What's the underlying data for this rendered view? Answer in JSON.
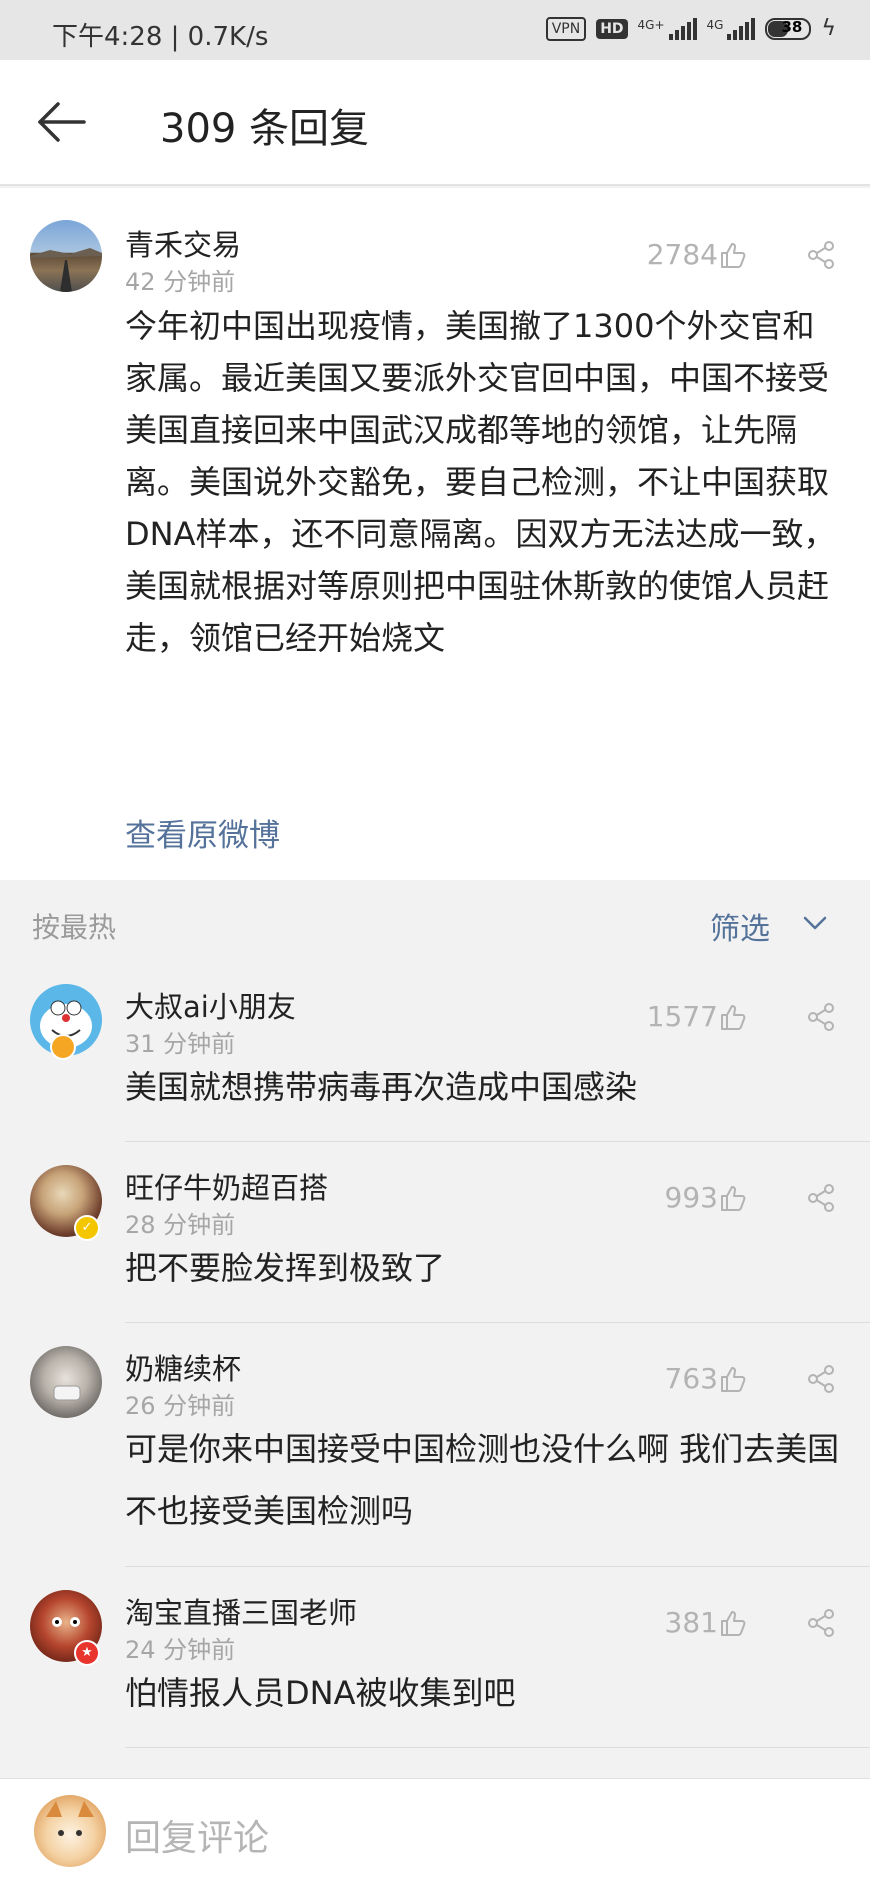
{
  "status_bar": {
    "time": "下午4:28 | 0.7K/s",
    "vpn": "VPN",
    "hd": "HD",
    "net1": "4G+",
    "net2": "4G",
    "battery": "38"
  },
  "header": {
    "title": "309 条回复",
    "back_icon": "back-arrow-icon"
  },
  "main_post": {
    "username": "青禾交易",
    "time": "42 分钟前",
    "likes": "2784",
    "body": "今年初中国出现疫情，美国撤了1300个外交官和家属。最近美国又要派外交官回中国，中国不接受美国直接回来中国武汉成都等地的领馆，让先隔离。美国说外交豁免，要自己检测，不让中国获取DNA样本，还不同意隔离。因双方无法达成一致，美国就根据对等原则把中国驻休斯敦的使馆人员赶走，领馆已经开始烧文",
    "view_original": "查看原微博"
  },
  "sort_bar": {
    "sort_label": "按最热",
    "filter_label": "筛选"
  },
  "comments": [
    {
      "username": "大叔ai小朋友",
      "time": "31 分钟前",
      "likes": "1577",
      "text": "美国就想携带病毒再次造成中国感染"
    },
    {
      "username": "旺仔牛奶超百搭",
      "time": "28 分钟前",
      "likes": "993",
      "text": "把不要脸发挥到极致了"
    },
    {
      "username": "奶糖续杯",
      "time": "26 分钟前",
      "likes": "763",
      "text": "可是你来中国接受中国检测也没什么啊 我们去美国 不也接受美国检测吗"
    },
    {
      "username": "淘宝直播三国老师",
      "time": "24 分钟前",
      "likes": "381",
      "text": "怕情报人员DNA被收集到吧"
    }
  ],
  "reply_bar": {
    "placeholder": "回复评论"
  },
  "colors": {
    "link": "#55739a",
    "muted": "#a6a6a6",
    "background": "#f2f2f2"
  }
}
